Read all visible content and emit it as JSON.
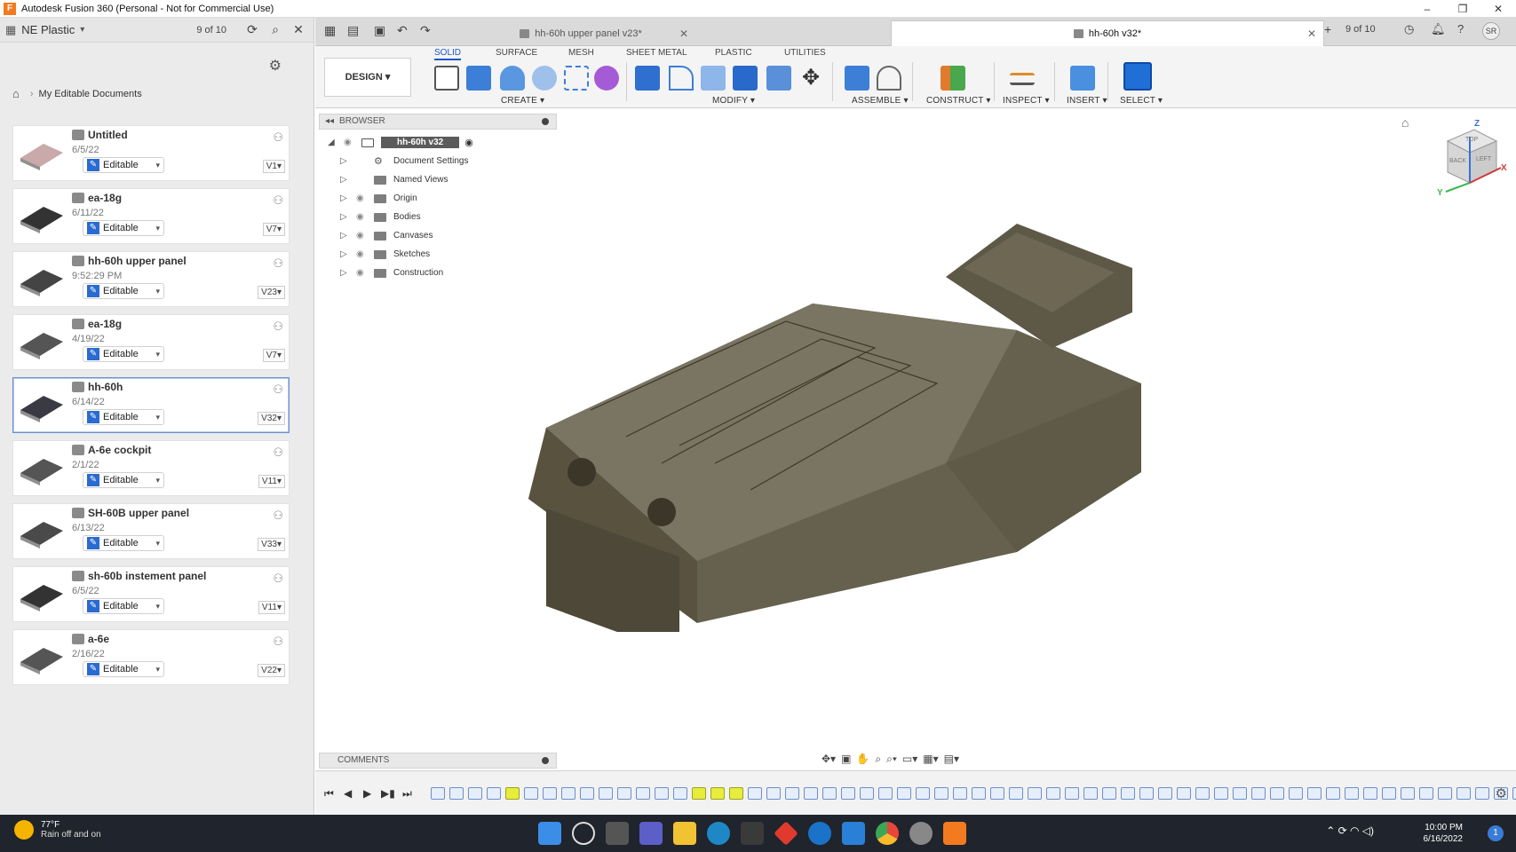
{
  "window": {
    "title": "Autodesk Fusion 360 (Personal - Not for Commercial Use)",
    "app_icon": "F",
    "controls": [
      "–",
      "❐",
      "✕"
    ]
  },
  "data_panel": {
    "team": "NE Plastic",
    "job_count": "9 of 10",
    "breadcrumb": "My Editable Documents",
    "documents": [
      {
        "name": "Untitled",
        "date": "6/5/22",
        "status": "Editable",
        "version": "V1"
      },
      {
        "name": "ea-18g",
        "date": "6/11/22",
        "status": "Editable",
        "version": "V7"
      },
      {
        "name": "hh-60h upper panel",
        "date": "9:52:29 PM",
        "status": "Editable",
        "version": "V23"
      },
      {
        "name": "ea-18g",
        "date": "4/19/22",
        "status": "Editable",
        "version": "V7"
      },
      {
        "name": "hh-60h",
        "date": "6/14/22",
        "status": "Editable",
        "version": "V32",
        "selected": true
      },
      {
        "name": "A-6e cockpit",
        "date": "2/1/22",
        "status": "Editable",
        "version": "V11"
      },
      {
        "name": "SH-60B upper panel",
        "date": "6/13/22",
        "status": "Editable",
        "version": "V33"
      },
      {
        "name": "sh-60b instement panel",
        "date": "6/5/22",
        "status": "Editable",
        "version": "V11"
      },
      {
        "name": "a-6e",
        "date": "2/16/22",
        "status": "Editable",
        "version": "V22"
      }
    ]
  },
  "tabs": [
    {
      "label": "hh-60h upper panel v23*",
      "active": false
    },
    {
      "label": "hh-60h v32*",
      "active": true
    }
  ],
  "tabs_right_count": "9 of 10",
  "user_initials": "SR",
  "toolbar": {
    "subtabs": [
      "SOLID",
      "SURFACE",
      "MESH",
      "SHEET METAL",
      "PLASTIC",
      "UTILITIES"
    ],
    "active_subtab": "SOLID",
    "workspace": "DESIGN",
    "groups": [
      "CREATE",
      "MODIFY",
      "ASSEMBLE",
      "CONSTRUCT",
      "INSPECT",
      "INSERT",
      "SELECT"
    ]
  },
  "browser": {
    "header": "BROWSER",
    "root": "hh-60h v32",
    "items": [
      "Document Settings",
      "Named Views",
      "Origin",
      "Bodies",
      "Canvases",
      "Sketches",
      "Construction"
    ]
  },
  "comments": {
    "label": "COMMENTS"
  },
  "viewcube": {
    "faces": [
      "TOP",
      "BACK",
      "LEFT"
    ],
    "axes": [
      "Z",
      "Y",
      "X"
    ]
  },
  "taskbar": {
    "weather_temp": "77°F",
    "weather_desc": "Rain off and on",
    "time": "10:00 PM",
    "date": "6/16/2022",
    "notification_count": "1"
  }
}
